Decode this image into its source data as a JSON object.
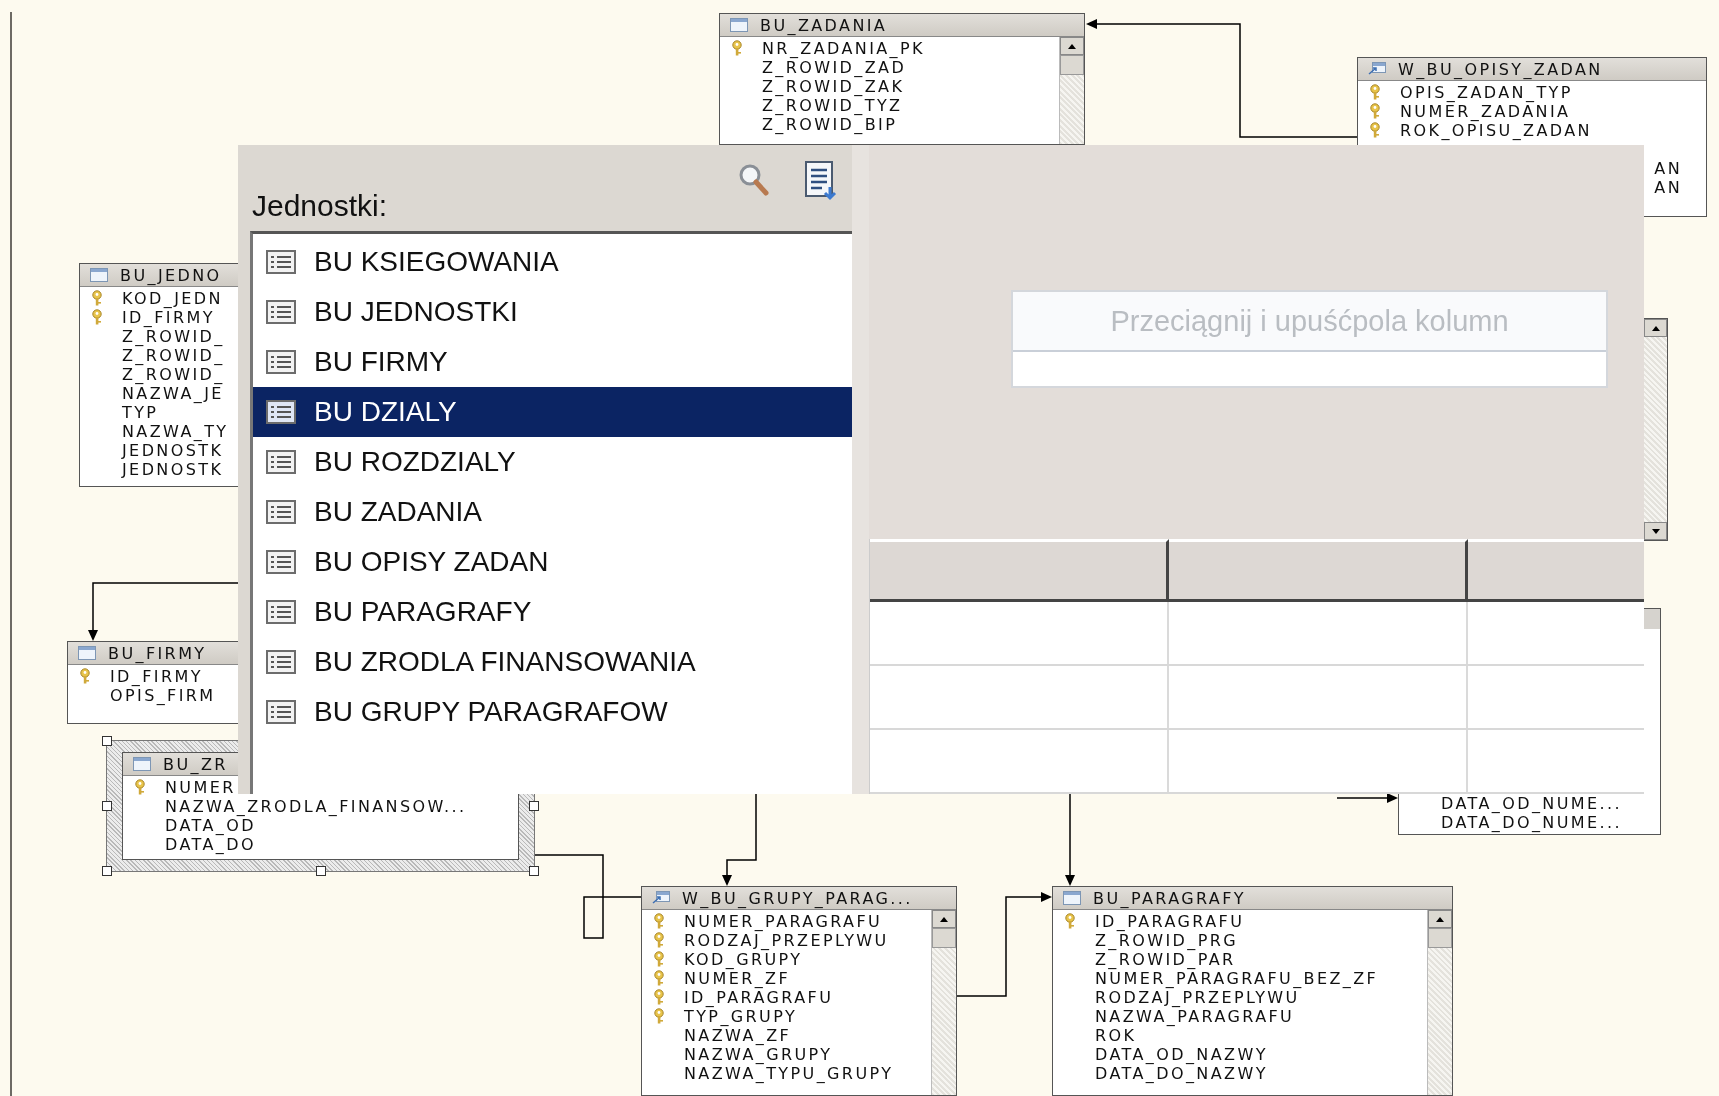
{
  "diagram": {
    "tables": [
      {
        "title": "BU_ZADANIA",
        "kind": "table",
        "selected": false,
        "scrollbar": true,
        "columns": [
          {
            "name": "NR_ZADANIA_PK",
            "key": true
          },
          {
            "name": "Z_ROWID_ZAD",
            "key": false
          },
          {
            "name": "Z_ROWID_ZAK",
            "key": false
          },
          {
            "name": "Z_ROWID_TYZ",
            "key": false
          },
          {
            "name": "Z_ROWID_BIP",
            "key": false
          }
        ]
      },
      {
        "title": "W_BU_OPISY_ZADAN",
        "kind": "view",
        "selected": false,
        "columns": [
          {
            "name": "OPIS_ZADAN_TYP",
            "key": true,
            "kind": "full"
          },
          {
            "name": "NUMER_ZADANIA",
            "key": true,
            "kind": "full"
          },
          {
            "name": "ROK_OPISU_ZADAN",
            "key": true,
            "kind": "full"
          },
          {
            "name": "AN",
            "key": false,
            "kind": "fragment"
          },
          {
            "name": "AN",
            "key": false,
            "kind": "fragment"
          }
        ]
      },
      {
        "title": "BU_JEDNO",
        "kind": "table",
        "selected": false,
        "columns": [
          {
            "name": "KOD_JEDN",
            "key": true
          },
          {
            "name": "ID_FIRMY",
            "key": true
          },
          {
            "name": "Z_ROWID_",
            "key": false
          },
          {
            "name": "Z_ROWID_",
            "key": false
          },
          {
            "name": "Z_ROWID_",
            "key": false
          },
          {
            "name": "NAZWA_JE",
            "key": false
          },
          {
            "name": "TYP",
            "key": false
          },
          {
            "name": "NAZWA_TY",
            "key": false
          },
          {
            "name": "JEDNOSTK",
            "key": false
          },
          {
            "name": "JEDNOSTK",
            "key": false
          }
        ]
      },
      {
        "title": "BU_FIRMY",
        "kind": "table",
        "selected": false,
        "columns": [
          {
            "name": "ID_FIRMY",
            "key": true
          },
          {
            "name": "OPIS_FIRM",
            "key": false
          }
        ]
      },
      {
        "title": "BU_ZR",
        "kind": "table",
        "selected": true,
        "columns": [
          {
            "name": "NUMER",
            "key": true
          },
          {
            "name": "NAZWA_ZRODLA_FINANSOW...",
            "key": false
          },
          {
            "name": "DATA_OD",
            "key": false
          },
          {
            "name": "DATA_DO",
            "key": false
          }
        ]
      },
      {
        "title": "W_BU_GRUPY_PARAG...",
        "kind": "view",
        "selected": false,
        "scrollbar": true,
        "columns": [
          {
            "name": "NUMER_PARAGRAFU",
            "key": true
          },
          {
            "name": "RODZAJ_PRZEPLYWU",
            "key": true
          },
          {
            "name": "KOD_GRUPY",
            "key": true
          },
          {
            "name": "NUMER_ZF",
            "key": true
          },
          {
            "name": "ID_PARAGRAFU",
            "key": true
          },
          {
            "name": "TYP_GRUPY",
            "key": true
          },
          {
            "name": "NAZWA_ZF",
            "key": false
          },
          {
            "name": "NAZWA_GRUPY",
            "key": false
          },
          {
            "name": "NAZWA_TYPU_GRUPY",
            "key": false
          }
        ]
      },
      {
        "title": "BU_PARAGRAFY",
        "kind": "table",
        "selected": false,
        "scrollbar": true,
        "columns": [
          {
            "name": "ID_PARAGRAFU",
            "key": true
          },
          {
            "name": "Z_ROWID_PRG",
            "key": false
          },
          {
            "name": "Z_ROWID_PAR",
            "key": false
          },
          {
            "name": "NUMER_PARAGRAFU_BEZ_ZF",
            "key": false
          },
          {
            "name": "RODZAJ_PRZEPLYWU",
            "key": false
          },
          {
            "name": "NAZWA_PARAGRAFU",
            "key": false
          },
          {
            "name": "ROK",
            "key": false
          },
          {
            "name": "DATA_OD_NAZWY",
            "key": false
          },
          {
            "name": "DATA_DO_NAZWY",
            "key": false
          }
        ]
      },
      {
        "selected": false,
        "columns": [
          {
            "name": "DATA_OD_NUME...",
            "key": false
          },
          {
            "name": "DATA_DO_NUME...",
            "key": false
          }
        ]
      }
    ]
  },
  "panel": {
    "label": "Jednostki:",
    "items": [
      {
        "label": "BU KSIEGOWANIA",
        "selected": false
      },
      {
        "label": "BU JEDNOSTKI",
        "selected": false
      },
      {
        "label": "BU FIRMY",
        "selected": false
      },
      {
        "label": "BU DZIALY",
        "selected": true
      },
      {
        "label": "BU ROZDZIALY",
        "selected": false
      },
      {
        "label": "BU ZADANIA",
        "selected": false
      },
      {
        "label": "BU OPISY ZADAN",
        "selected": false
      },
      {
        "label": "BU PARAGRAFY",
        "selected": false
      },
      {
        "label": "BU ZRODLA FINANSOWANIA",
        "selected": false
      },
      {
        "label": "BU GRUPY PARAGRAFOW",
        "selected": false
      }
    ],
    "drop_zone": {
      "placeholder": "Przeciągnij i upuśćpola kolumn"
    }
  }
}
